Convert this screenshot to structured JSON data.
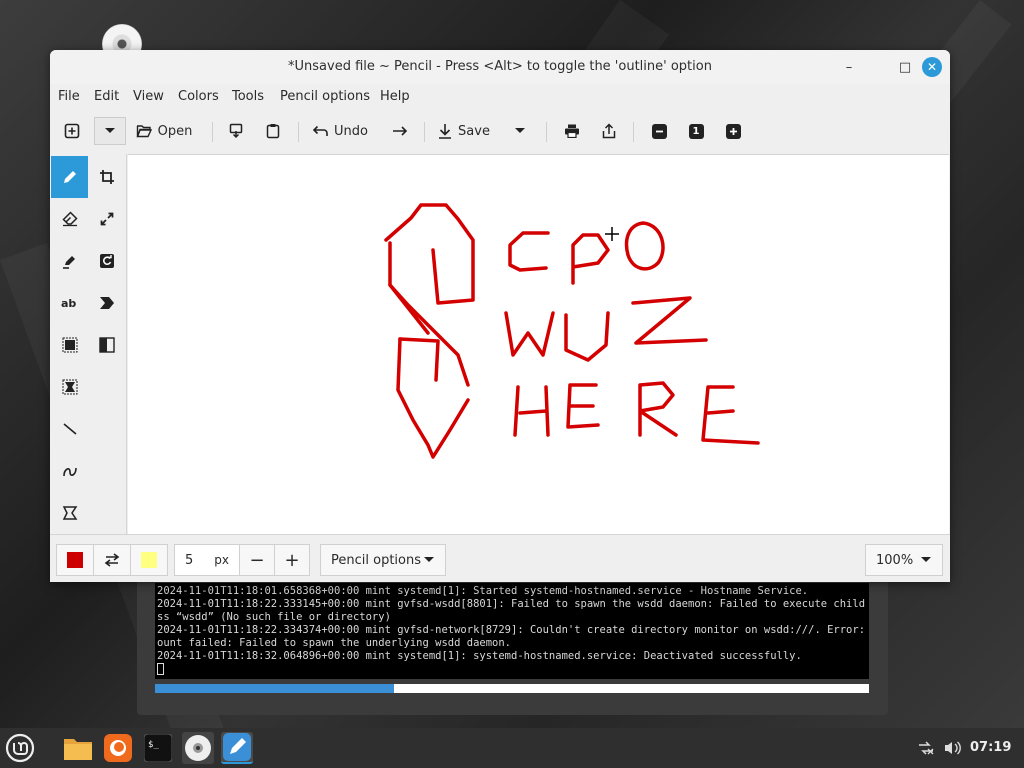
{
  "window": {
    "title": "*Unsaved file ~ Pencil - Press <Alt> to toggle the 'outline' option",
    "minimize": "–",
    "maximize": "□",
    "close": "✕"
  },
  "menubar": {
    "items": [
      "File",
      "Edit",
      "View",
      "Colors",
      "Tools",
      "Pencil options",
      "Help"
    ]
  },
  "toolbar": {
    "open_label": "Open",
    "undo_label": "Undo",
    "save_label": "Save",
    "zoom_indicator": "1"
  },
  "canvas": {
    "drawn_text": [
      "CPO",
      "WUZ",
      "HERE"
    ],
    "stroke_color": "#d40000"
  },
  "bottombar": {
    "primary_color": "#cc0000",
    "secondary_color": "#ffff80",
    "size_value": "5",
    "size_unit": "px",
    "minus": "−",
    "plus": "+",
    "options_label": "Pencil options",
    "zoom_value": "100%"
  },
  "terminal": {
    "lines": [
      "2024-11-01T11:18:01.658368+00:00 mint systemd[1]: Started systemd-hostnamed.service - Hostname Service.",
      "2024-11-01T11:18:22.333145+00:00 mint gvfsd-wsdd[8801]: Failed to spawn the wsdd daemon: Failed to execute child proce",
      "ss “wsdd” (No such file or directory)",
      "2024-11-01T11:18:22.334374+00:00 mint gvfsd-network[8729]: Couldn't create directory monitor on wsdd:///. Error: Autom",
      "ount failed: Failed to spawn the underlying wsdd daemon.",
      "2024-11-01T11:18:32.064896+00:00 mint systemd[1]: systemd-hostnamed.service: Deactivated successfully."
    ],
    "progress": 0.335
  },
  "taskbar": {
    "clock": "07:19"
  },
  "colors": {
    "accent": "#2c9ad8"
  }
}
